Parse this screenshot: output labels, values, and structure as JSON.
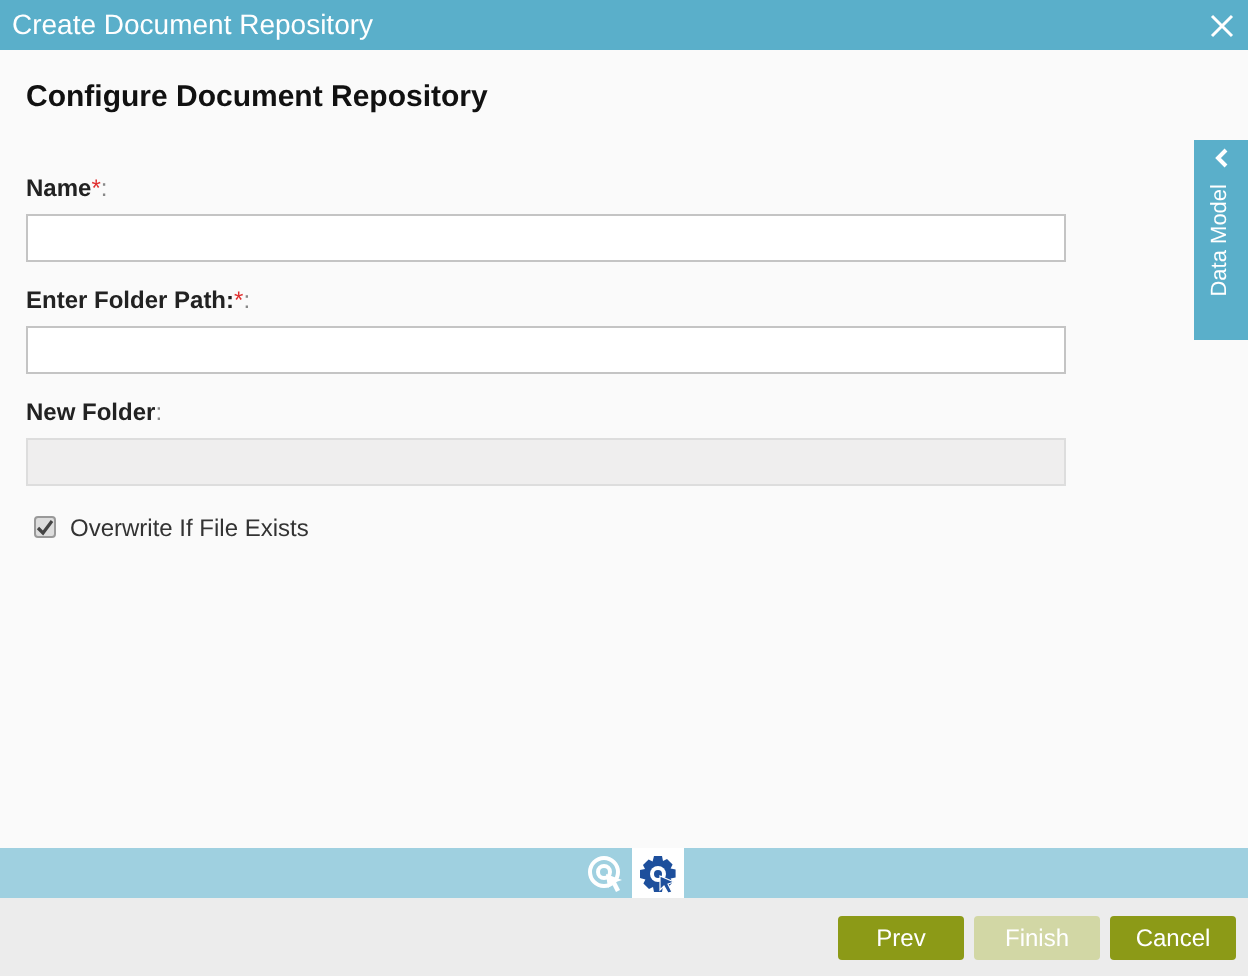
{
  "window": {
    "title": "Create Document Repository"
  },
  "heading": "Configure Document Repository",
  "fields": [
    {
      "label": "Name ",
      "required_mark": "*",
      "colon": ":",
      "disabled": false
    },
    {
      "label": "Enter Folder Path:",
      "required_mark": "*",
      "colon": ":",
      "disabled": false
    },
    {
      "label": "New Folder",
      "colon": ":",
      "disabled": true
    }
  ],
  "checkbox": {
    "label": "Overwrite If File Exists",
    "checked": true
  },
  "side_tab": {
    "label": "Data Model"
  },
  "bottom_tabs": [
    {
      "kind": "target",
      "selected": false
    },
    {
      "kind": "gear",
      "selected": true
    }
  ],
  "buttons": [
    {
      "label": "Prev",
      "disabled": false
    },
    {
      "label": "Finish",
      "disabled": true
    },
    {
      "label": "Cancel",
      "disabled": false
    }
  ]
}
